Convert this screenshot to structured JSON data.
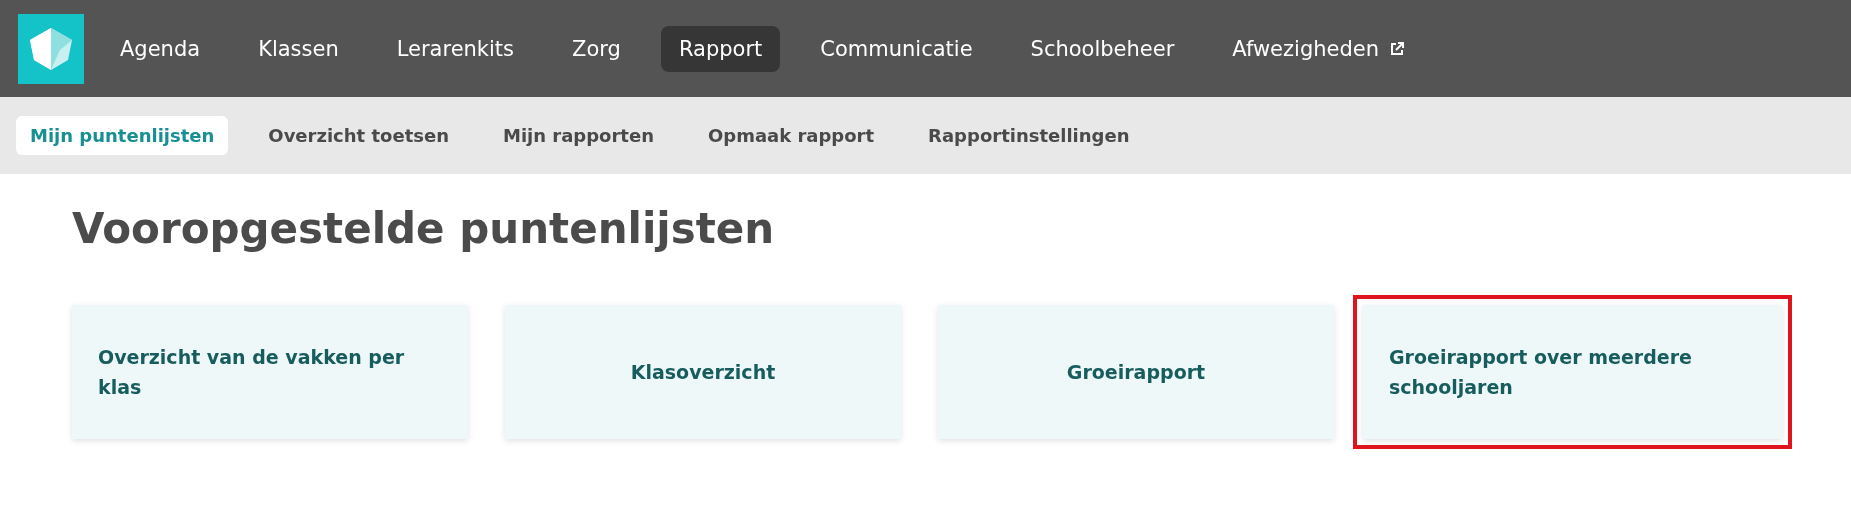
{
  "nav": {
    "items": [
      {
        "label": "Agenda",
        "selected": false,
        "external": false
      },
      {
        "label": "Klassen",
        "selected": false,
        "external": false
      },
      {
        "label": "Lerarenkits",
        "selected": false,
        "external": false
      },
      {
        "label": "Zorg",
        "selected": false,
        "external": false
      },
      {
        "label": "Rapport",
        "selected": true,
        "external": false
      },
      {
        "label": "Communicatie",
        "selected": false,
        "external": false
      },
      {
        "label": "Schoolbeheer",
        "selected": false,
        "external": false
      },
      {
        "label": "Afwezigheden",
        "selected": false,
        "external": true
      }
    ]
  },
  "subnav": {
    "items": [
      {
        "label": "Mijn puntenlijsten",
        "selected": true
      },
      {
        "label": "Overzicht toetsen",
        "selected": false
      },
      {
        "label": "Mijn rapporten",
        "selected": false
      },
      {
        "label": "Opmaak rapport",
        "selected": false
      },
      {
        "label": "Rapportinstellingen",
        "selected": false
      }
    ]
  },
  "page": {
    "title": "Vooropgestelde puntenlijsten",
    "cards": [
      {
        "label": "Overzicht van de vakken per klas",
        "highlighted": false
      },
      {
        "label": "Klasoverzicht",
        "highlighted": false
      },
      {
        "label": "Groeirapport",
        "highlighted": false
      },
      {
        "label": "Groeirapport over meerdere schooljaren",
        "highlighted": true
      }
    ]
  }
}
